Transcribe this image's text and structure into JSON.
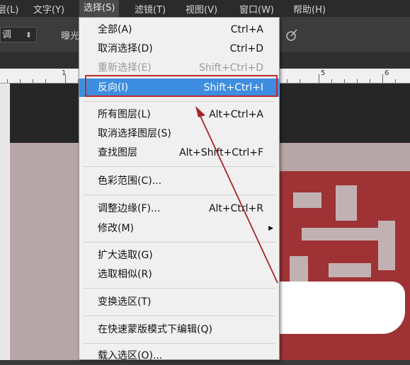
{
  "menubar": {
    "items": [
      {
        "label": "层(L)"
      },
      {
        "label": "文字(Y)"
      },
      {
        "label": "选择(S)"
      },
      {
        "label": "滤镜(T)"
      },
      {
        "label": "视图(V)"
      },
      {
        "label": "窗口(W)"
      },
      {
        "label": "帮助(H)"
      }
    ]
  },
  "options": {
    "dropdown_value": "调",
    "exposure_label": "曝光"
  },
  "ruler": {
    "labels": [
      "1",
      "5",
      "6"
    ]
  },
  "select_menu": {
    "items": [
      {
        "label": "全部(A)",
        "shortcut": "Ctrl+A"
      },
      {
        "label": "取消选择(D)",
        "shortcut": "Ctrl+D"
      },
      {
        "label": "重新选择(E)",
        "shortcut": "Shift+Ctrl+D"
      },
      {
        "label": "反向(I)",
        "shortcut": "Shift+Ctrl+I"
      },
      {
        "label": "所有图层(L)",
        "shortcut": "Alt+Ctrl+A"
      },
      {
        "label": "取消选择图层(S)",
        "shortcut": ""
      },
      {
        "label": "查找图层",
        "shortcut": "Alt+Shift+Ctrl+F"
      },
      {
        "label": "色彩范围(C)...",
        "shortcut": ""
      },
      {
        "label": "调整边缘(F)...",
        "shortcut": "Alt+Ctrl+R"
      },
      {
        "label": "修改(M)",
        "shortcut": ""
      },
      {
        "label": "扩大选取(G)",
        "shortcut": ""
      },
      {
        "label": "选取相似(R)",
        "shortcut": ""
      },
      {
        "label": "变换选区(T)",
        "shortcut": ""
      },
      {
        "label": "在快速蒙版模式下编辑(Q)",
        "shortcut": ""
      },
      {
        "label": "载入选区(O)...",
        "shortcut": ""
      }
    ]
  },
  "colors": {
    "highlight": "#3d8ee0",
    "annotation_red": "#c0282d",
    "seal_red": "#9e3235"
  }
}
